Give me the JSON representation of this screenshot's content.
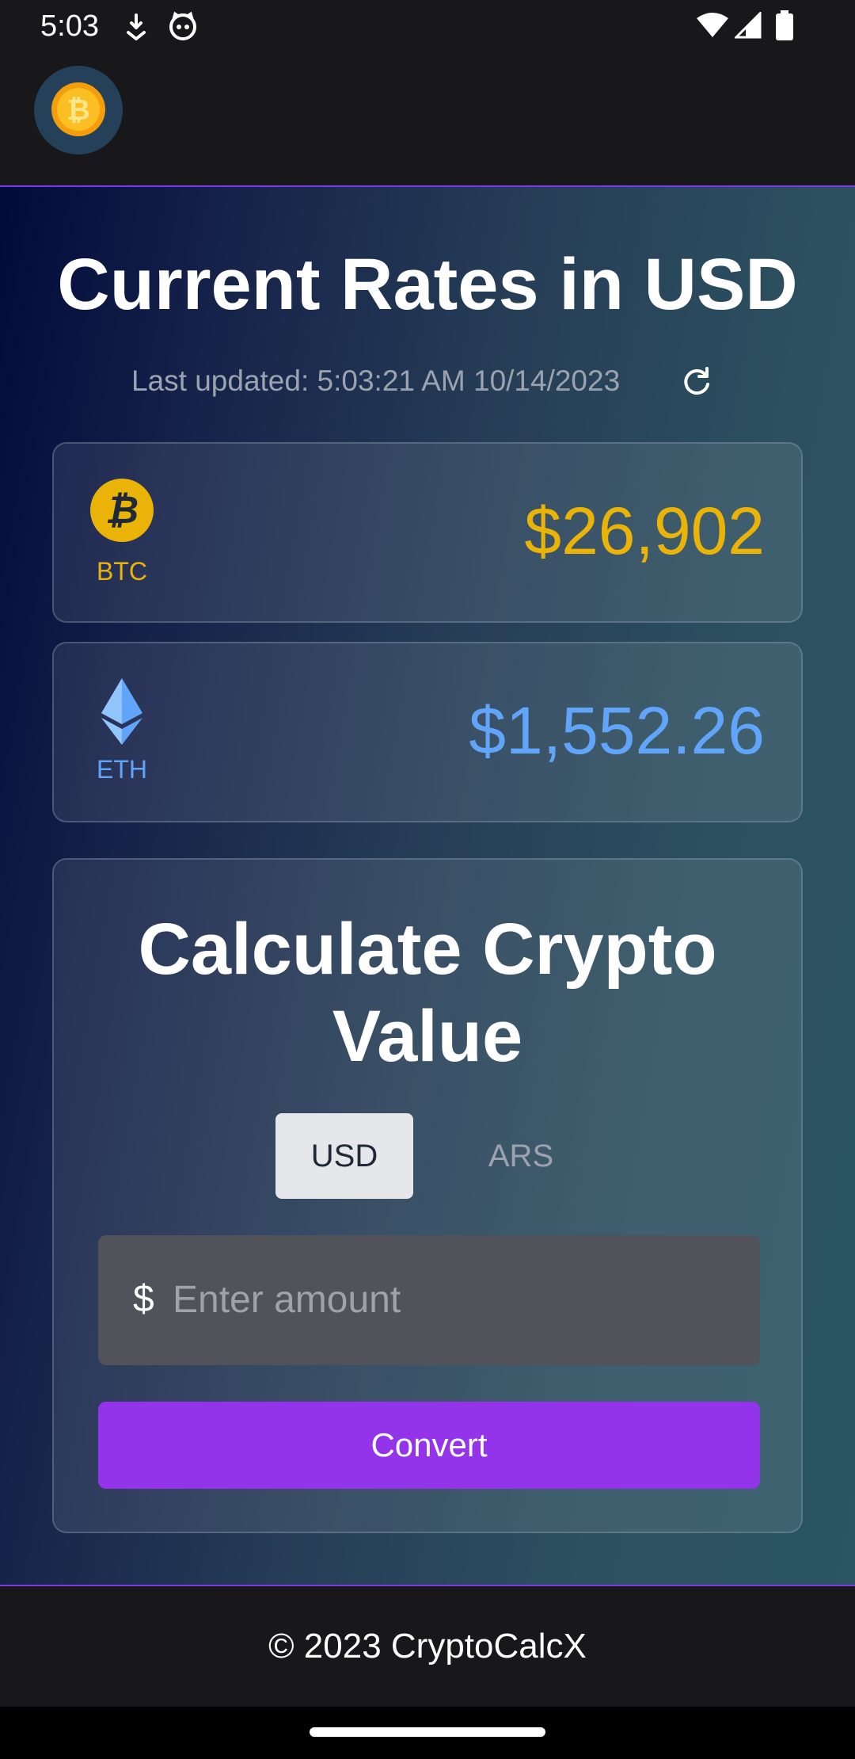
{
  "status_bar": {
    "time": "5:03",
    "icons": [
      "download-icon",
      "cat-notification-icon",
      "wifi-icon",
      "signal-icon",
      "battery-icon"
    ]
  },
  "header": {
    "logo_icon": "bitcoin-logo-icon"
  },
  "rates": {
    "title": "Current Rates in USD",
    "last_updated": "Last updated: 5:03:21 AM 10/14/2023",
    "refresh_icon": "refresh-icon",
    "coins": [
      {
        "symbol": "BTC",
        "price": "$26,902",
        "icon": "bitcoin-icon",
        "color": "#eab308"
      },
      {
        "symbol": "ETH",
        "price": "$1,552.26",
        "icon": "ethereum-icon",
        "color": "#60a5fa"
      }
    ]
  },
  "calculator": {
    "title_line1": "Calculate Crypto",
    "title_line2": "Value",
    "currency_options": [
      "USD",
      "ARS"
    ],
    "selected_currency": "USD",
    "currency_symbol": "$",
    "amount_value": "",
    "amount_placeholder": "Enter amount",
    "convert_label": "Convert"
  },
  "footer": {
    "text": "© 2023 CryptoCalcX"
  },
  "colors": {
    "accent": "#9333ea",
    "border_accent": "#7c3aed",
    "btc": "#eab308",
    "eth": "#60a5fa"
  }
}
